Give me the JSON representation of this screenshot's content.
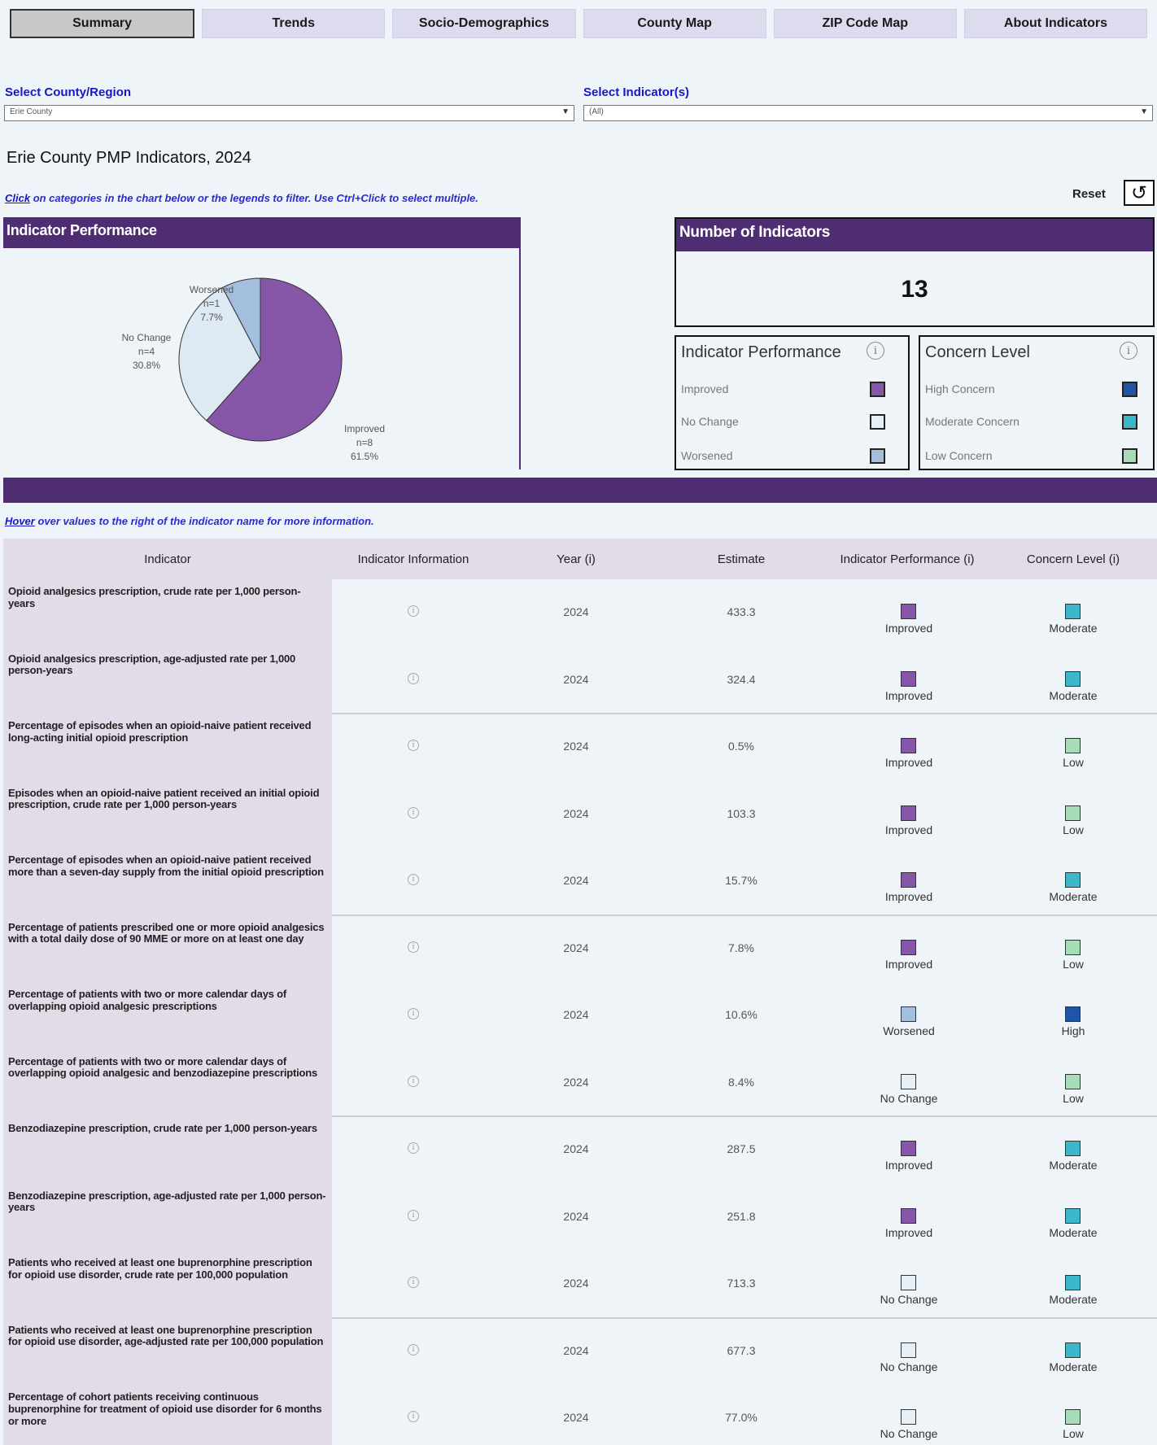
{
  "tabs": [
    "Summary",
    "Trends",
    "Socio-Demographics",
    "County Map",
    "ZIP Code Map",
    "About Indicators"
  ],
  "selectors": {
    "county_label": "Select County/Region",
    "county_value": "Erie County",
    "indicator_label": "Select Indicator(s)",
    "indicator_value": "(All)"
  },
  "page_title": "Erie County PMP Indicators, 2024",
  "hint_top": {
    "link": "Click",
    "text": " on categories in the chart below or the legends to filter. Use Ctrl+Click to select multiple."
  },
  "reset_label": "Reset",
  "pie_panel": {
    "title": "Indicator Performance",
    "labels": [
      {
        "name": "Worsened",
        "n": "n=1",
        "pct": "7.7%"
      },
      {
        "name": "No Change",
        "n": "n=4",
        "pct": "30.8%"
      },
      {
        "name": "Improved",
        "n": "n=8",
        "pct": "61.5%"
      }
    ]
  },
  "chart_data": {
    "type": "pie",
    "slices": [
      {
        "label": "Improved",
        "count": 8,
        "percent": 61.5,
        "color": "#8657a8"
      },
      {
        "label": "No Change",
        "count": 4,
        "percent": 30.8,
        "color": "#dde9f3"
      },
      {
        "label": "Worsened",
        "count": 1,
        "percent": 7.7,
        "color": "#a3bfdd"
      }
    ]
  },
  "kpi": {
    "title": "Number of Indicators",
    "value": "13"
  },
  "legend_performance": {
    "title": "Indicator Performance",
    "items": [
      {
        "label": "Improved",
        "color": "#8657a8"
      },
      {
        "label": "No Change",
        "color": "#e6eef6"
      },
      {
        "label": "Worsened",
        "color": "#a3bfdd"
      }
    ]
  },
  "legend_concern": {
    "title": "Concern Level",
    "items": [
      {
        "label": "High Concern",
        "color": "#1f55a6"
      },
      {
        "label": "Moderate Concern",
        "color": "#3cb7c9"
      },
      {
        "label": "Low Concern",
        "color": "#a6dcb8"
      }
    ]
  },
  "hint_table": {
    "link": "Hover",
    "text": " over values to the right of the indicator name for more information."
  },
  "table": {
    "headers": [
      "Indicator",
      "Indicator Information",
      "Year (i)",
      "Estimate",
      "Indicator Performance (i)",
      "Concern Level (i)"
    ],
    "rows": [
      {
        "name": "Opioid analgesics prescription, crude rate per 1,000 person-years",
        "year": "2024",
        "estimate": "433.3",
        "perf": "Improved",
        "concern": "Moderate"
      },
      {
        "name": "Opioid analgesics prescription, age-adjusted rate per 1,000 person-years",
        "year": "2024",
        "estimate": "324.4",
        "perf": "Improved",
        "concern": "Moderate"
      },
      {
        "name": "Percentage of episodes when an opioid-naive patient received long-acting initial opioid prescription",
        "year": "2024",
        "estimate": "0.5%",
        "perf": "Improved",
        "concern": "Low"
      },
      {
        "name": "Episodes when an opioid-naive patient received an initial opioid prescription, crude rate per 1,000 person-years",
        "year": "2024",
        "estimate": "103.3",
        "perf": "Improved",
        "concern": "Low"
      },
      {
        "name": "Percentage of episodes when an opioid-naive patient received more than a seven-day supply from the initial opioid prescription",
        "year": "2024",
        "estimate": "15.7%",
        "perf": "Improved",
        "concern": "Moderate"
      },
      {
        "name": "Percentage of patients prescribed one or more opioid analgesics with a total daily dose of 90 MME or more on at least one day",
        "year": "2024",
        "estimate": "7.8%",
        "perf": "Improved",
        "concern": "Low"
      },
      {
        "name": "Percentage of patients with two or more calendar days of overlapping opioid analgesic prescriptions",
        "year": "2024",
        "estimate": "10.6%",
        "perf": "Worsened",
        "concern": "High"
      },
      {
        "name": "Percentage of patients with two or more calendar days of overlapping opioid analgesic and benzodiazepine prescriptions",
        "year": "2024",
        "estimate": "8.4%",
        "perf": "No Change",
        "concern": "Low"
      },
      {
        "name": "Benzodiazepine prescription, crude rate per 1,000 person-years",
        "year": "2024",
        "estimate": "287.5",
        "perf": "Improved",
        "concern": "Moderate"
      },
      {
        "name": "Benzodiazepine prescription, age-adjusted rate per 1,000 person-years",
        "year": "2024",
        "estimate": "251.8",
        "perf": "Improved",
        "concern": "Moderate"
      },
      {
        "name": "Patients who received at least one buprenorphine prescription for opioid use disorder, crude rate per 100,000 population",
        "year": "2024",
        "estimate": "713.3",
        "perf": "No Change",
        "concern": "Moderate"
      },
      {
        "name": "Patients who received at least one buprenorphine prescription for opioid use disorder, age-adjusted rate per 100,000 population",
        "year": "2024",
        "estimate": "677.3",
        "perf": "No Change",
        "concern": "Moderate"
      },
      {
        "name": "Percentage of cohort patients receiving continuous buprenorphine for treatment of opioid use disorder for 6 months or more",
        "year": "2024",
        "estimate": "77.0%",
        "perf": "No Change",
        "concern": "Low"
      }
    ]
  }
}
